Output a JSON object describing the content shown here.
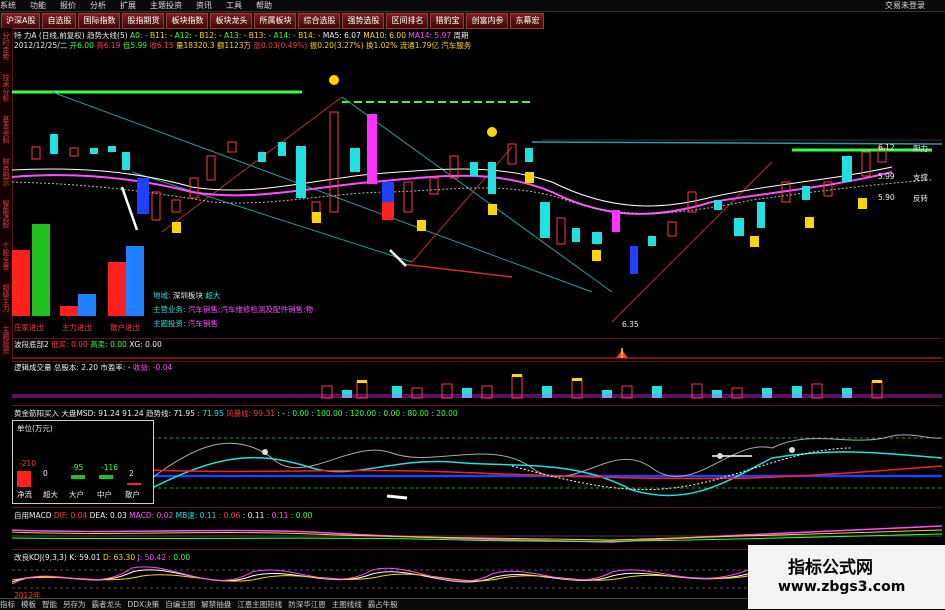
{
  "menu": {
    "items": [
      "系统",
      "功能",
      "报价",
      "分析",
      "扩展",
      "主题投资",
      "资讯",
      "工具",
      "帮助"
    ],
    "login": "交易未登录"
  },
  "toolbar": {
    "tabs": [
      "沪深A股",
      "自选股",
      "国际指数",
      "股指期货",
      "板块指数",
      "板块龙头",
      "所属板块",
      "综合选股",
      "强势选股",
      "区间排名",
      "猎豹宝",
      "创富内参",
      "东幕宏"
    ]
  },
  "sidenav": {
    "items": [
      "分时走势",
      "技术分析",
      "基本资料",
      "财务图示",
      "智能选股",
      "个股全景",
      "超级主力",
      "主题投资"
    ]
  },
  "stock": {
    "line1_name": "特  力A (日线,前复权) 趋势大线(5)",
    "ma_labels": [
      "A0: -",
      "B11: -",
      "A12: -",
      "B12: -",
      "A13: -",
      "B13: -",
      "A14: -",
      "B14: -"
    ],
    "ma5": "MA5: 6.07",
    "ma10": "MA10: 6.00",
    "ma14": "MA14: 5.97",
    "period": "周期",
    "line2_date": "2012/12/25/二",
    "open": "开6.00",
    "high": "高6.19",
    "low": "低5.99",
    "close": "收6.15",
    "vol": "量18320.3",
    "amount": "额1123万",
    "change": "涨0.03(0.49%)",
    "amp": "振0.20(3.27%)",
    "turnover": "换1.02%",
    "float": "流通1.79亿",
    "sector": "汽车服务"
  },
  "price_marks": {
    "hi": "6.12",
    "mid": "5.99",
    "lo": "5.90",
    "min": "6.35",
    "resist": "阻力",
    "support": "支撑",
    "reverse": "反转"
  },
  "left_bars": {
    "labels": [
      "庄家进出",
      "主力进出",
      "散户进出"
    ]
  },
  "info": {
    "region_label": "地域:",
    "region_val": "深圳板块",
    "region_tag": "超大",
    "concept_label": "主营业务:",
    "concept_val": "汽车销售;汽车维修检测及配件销售;物",
    "theme_label": "主题投资:",
    "theme_val": "汽车销售"
  },
  "panel1": {
    "title": "波段底部2",
    "a": "低买: 0.00",
    "b": "高卖: 0.00",
    "c": "XG: 0.00"
  },
  "panel2": {
    "title": "逻辑成交量",
    "a": "总股本: 2.20",
    "b": "市盈率: -",
    "c": "收益: -0.04"
  },
  "panel3": {
    "title": "黄金箭阳买入",
    "a": "大盘MSD: 91.24",
    "b": "91.24",
    "c": "趋势线: 71.95",
    "d": ": 71.95",
    "e": "风暴线: 99.31",
    "f": ": -",
    "g": ": 0.00",
    "h": ": 0.00",
    "i": ": 80.00",
    "j": ": 20.00",
    "k": ": 100.00",
    "l": ": 120.00"
  },
  "daybox": {
    "title": "单位(万元)",
    "vals": [
      "-210",
      "0",
      "-95",
      "-116",
      "2"
    ],
    "labels": [
      "净流",
      "超大",
      "大户",
      "中户",
      "散户"
    ]
  },
  "panel4": {
    "title": "自用MACD",
    "a": "DIF: 0.04",
    "b": "DEA: 0.03",
    "c": "MACD: 0.02",
    "d": "MB速: 0.11",
    "e": ": 0.06",
    "f": ": 0.11",
    "g": ": 0.11",
    "h": ": 0.00"
  },
  "panel5": {
    "title": "改良KDJ(9,3,3)",
    "a": "K: 59.01",
    "b": "D: 63.30",
    "c": "J: 50.42",
    "d": ": 0.00"
  },
  "bottom": {
    "items": [
      "指标",
      "模板",
      "智能",
      "另存为",
      "霸者龙头",
      "DDX决策",
      "自编主图",
      "解禁抽盘",
      "江恩主图短线",
      "防深华江恩",
      "主图线线",
      "霸占牛股"
    ],
    "year": "2012年"
  },
  "watermark": {
    "line1": "指标公式网",
    "line2": "www.zbgs3.com"
  },
  "colors": {
    "up": "#ff3b3b",
    "down": "#22e0e0",
    "accent": "#ffd500"
  }
}
